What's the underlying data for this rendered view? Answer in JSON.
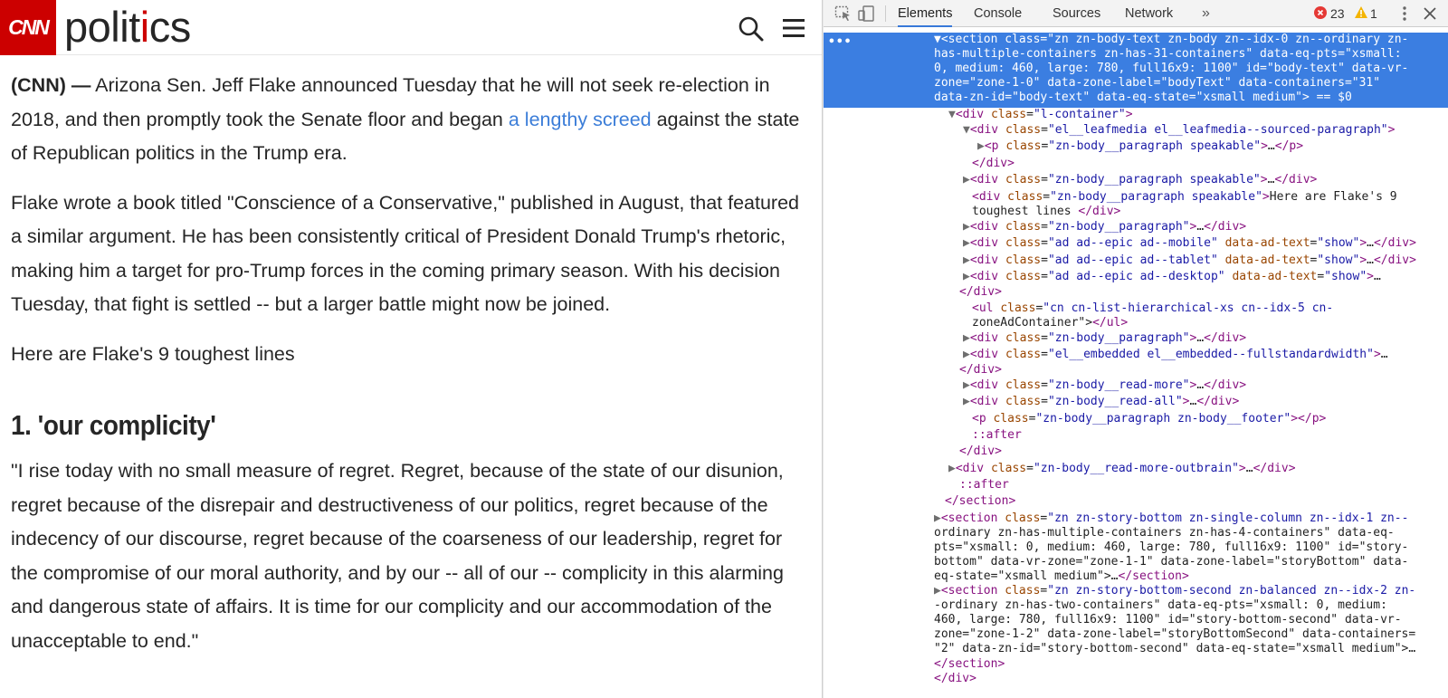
{
  "header": {
    "logo_text": "CNN",
    "section_title": "politics",
    "section_title_accent": "#cc0000"
  },
  "article": {
    "p1_dateline": "(CNN) —",
    "p1_before_link": " Arizona Sen. Jeff Flake announced Tuesday that he will not seek re-election in 2018, and then promptly took the Senate floor and began ",
    "p1_link": "a lengthy screed",
    "p1_after_link": " against the state of Republican politics in the Trump era.",
    "p2": "Flake wrote a book titled \"Conscience of a Conservative,\" published in August, that featured a similar argument. He has been consistently critical of President Donald Trump's rhetoric, making him a target for pro-Trump forces in the coming primary season. With his decision Tuesday, that fight is settled -- but a larger battle might now be joined.",
    "p3": "Here are Flake's 9 toughest lines",
    "subhead": "1. 'our complicity'",
    "p4": "\"I rise today with no small measure of regret. Regret, because of the state of our disunion, regret because of the disrepair and destructiveness of our politics, regret because of the indecency of our discourse, regret because of the coarseness of our leadership, regret for the compromise of our moral authority, and by our -- all of our -- complicity in this alarming and dangerous state of affairs. It is time for our complicity and our accommodation of the unacceptable to end.\""
  },
  "devtools": {
    "tabs": [
      "Elements",
      "Console",
      "Sources",
      "Network"
    ],
    "active_tab": "Elements",
    "more_tabs": "»",
    "error_count": "23",
    "warning_count": "1",
    "selected_marker": "•••",
    "dom_lines": [
      "▼<section class=\"zn zn-body-text zn-body zn--idx-0 zn--ordinary zn-",
      "has-multiple-containers zn-has-31-containers\" data-eq-pts=\"xsmall:",
      "0, medium: 460, large: 780, full16x9: 1100\" id=\"body-text\" data-vr-",
      "zone=\"zone-1-0\" data-zone-label=\"bodyText\" data-containers=\"31\"",
      "data-zn-id=\"body-text\" data-eq-state=\"xsmall medium\"> == $0",
      "▼<div class=\"l-container\">",
      "▼<div class=\"el__leafmedia el__leafmedia--sourced-paragraph\">",
      "▶<p class=\"zn-body__paragraph speakable\">…</p>",
      "</div>",
      "▶<div class=\"zn-body__paragraph speakable\">…</div>",
      "<div class=\"zn-body__paragraph speakable\">Here are Flake's 9",
      "toughest lines </div>",
      "▶<div class=\"zn-body__paragraph\">…</div>",
      "▶<div class=\"ad ad--epic ad--mobile\" data-ad-text=\"show\">…</div>",
      "▶<div class=\"ad ad--epic ad--tablet\" data-ad-text=\"show\">…</div>",
      "▶<div class=\"ad ad--epic ad--desktop\" data-ad-text=\"show\">…",
      "</div>",
      "<ul class=\"cn cn-list-hierarchical-xs cn--idx-5 cn-",
      "zoneAdContainer\"></ul>",
      "▶<div class=\"zn-body__paragraph\">…</div>",
      "▶<div class=\"el__embedded el__embedded--fullstandardwidth\">…",
      "</div>",
      "▶<div class=\"zn-body__read-more\">…</div>",
      "▶<div class=\"zn-body__read-all\">…</div>",
      "<p class=\"zn-body__paragraph zn-body__footer\"></p>",
      "::after",
      "</div>",
      "▶<div class=\"zn-body__read-more-outbrain\">…</div>",
      "::after",
      "</section>",
      "▶<section class=\"zn zn-story-bottom zn-single-column zn--idx-1 zn--",
      "ordinary zn-has-multiple-containers zn-has-4-containers\" data-eq-",
      "pts=\"xsmall: 0, medium: 460, large: 780, full16x9: 1100\" id=\"story-",
      "bottom\" data-vr-zone=\"zone-1-1\" data-zone-label=\"storyBottom\" data-",
      "eq-state=\"xsmall medium\">…</section>",
      "▶<section class=\"zn zn-story-bottom-second zn-balanced zn--idx-2 zn-",
      "-ordinary zn-has-two-containers\" data-eq-pts=\"xsmall: 0, medium:",
      "460, large: 780, full16x9: 1100\" id=\"story-bottom-second\" data-vr-",
      "zone=\"zone-1-2\" data-zone-label=\"storyBottomSecond\" data-containers=",
      "\"2\" data-zn-id=\"story-bottom-second\" data-eq-state=\"xsmall medium\">…",
      "</section>",
      "</div>"
    ]
  }
}
